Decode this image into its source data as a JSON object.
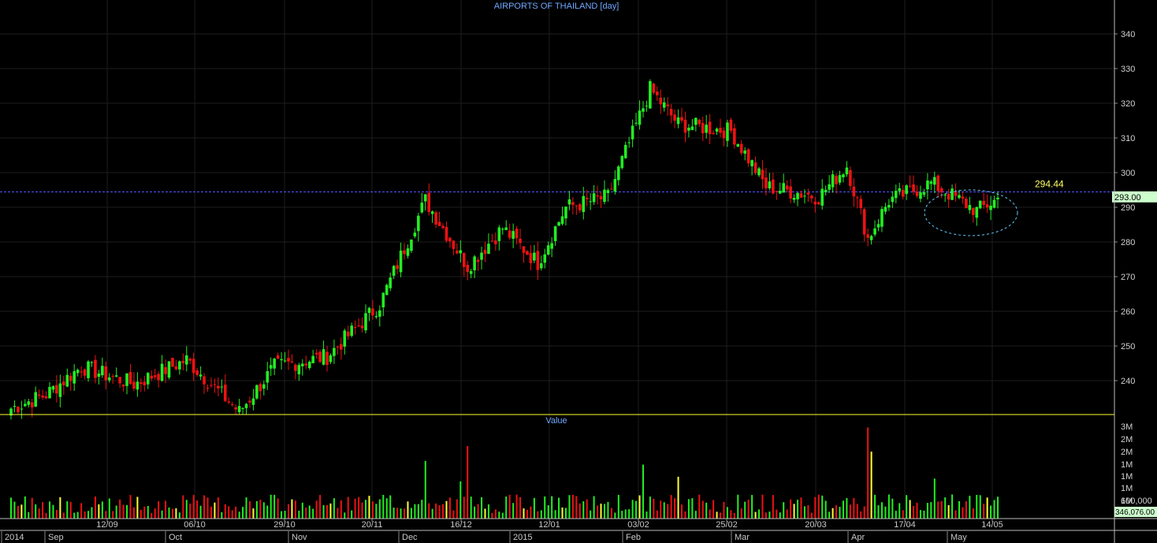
{
  "chart_data": [
    {
      "type": "candlestick",
      "title": "AIRPORTS OF THAILAND [day]",
      "ylim": [
        231,
        345
      ],
      "y_ticks": [
        240,
        250,
        260,
        270,
        280,
        290,
        300,
        310,
        320,
        330,
        340
      ],
      "y_tick_labels": [
        "240",
        "250",
        "260",
        "270",
        "280",
        "290",
        "300",
        "310",
        "320",
        "330",
        "340"
      ],
      "reference_line": {
        "value": 294.44,
        "label": "294.44",
        "color": "#5555ff"
      },
      "last_price": {
        "value": 293.0,
        "label": "293.00"
      },
      "annotation": "dashed ellipse around May consolidation",
      "grid": true,
      "x_labels_top": [
        "12/09",
        "06/10",
        "29/10",
        "20/11",
        "16/12",
        "12/01",
        "03/02",
        "25/02",
        "20/03",
        "17/04",
        "14/05"
      ],
      "x_labels_bottom": [
        "2014",
        "Sep",
        "Oct",
        "Nov",
        "Dec",
        "2015",
        "Feb",
        "Mar",
        "Apr",
        "May"
      ],
      "series_segments": [
        {
          "from": 0,
          "to": 10,
          "start": 232,
          "end": 236
        },
        {
          "from": 10,
          "to": 20,
          "start": 236,
          "end": 244
        },
        {
          "from": 20,
          "to": 35,
          "start": 244,
          "end": 239
        },
        {
          "from": 35,
          "to": 50,
          "start": 239,
          "end": 246
        },
        {
          "from": 50,
          "to": 65,
          "start": 246,
          "end": 231
        },
        {
          "from": 65,
          "to": 75,
          "start": 231,
          "end": 244
        },
        {
          "from": 75,
          "to": 90,
          "start": 244,
          "end": 247
        },
        {
          "from": 90,
          "to": 105,
          "start": 247,
          "end": 262
        },
        {
          "from": 105,
          "to": 118,
          "start": 262,
          "end": 292
        },
        {
          "from": 118,
          "to": 130,
          "start": 292,
          "end": 273
        },
        {
          "from": 130,
          "to": 140,
          "start": 273,
          "end": 284
        },
        {
          "from": 140,
          "to": 150,
          "start": 284,
          "end": 274
        },
        {
          "from": 150,
          "to": 158,
          "start": 274,
          "end": 290
        },
        {
          "from": 158,
          "to": 170,
          "start": 290,
          "end": 293
        },
        {
          "from": 170,
          "to": 182,
          "start": 293,
          "end": 324
        },
        {
          "from": 182,
          "to": 190,
          "start": 324,
          "end": 314
        },
        {
          "from": 190,
          "to": 205,
          "start": 314,
          "end": 312
        },
        {
          "from": 205,
          "to": 215,
          "start": 312,
          "end": 296
        },
        {
          "from": 215,
          "to": 230,
          "start": 296,
          "end": 293
        },
        {
          "from": 230,
          "to": 238,
          "start": 293,
          "end": 302
        },
        {
          "from": 238,
          "to": 244,
          "start": 302,
          "end": 281
        },
        {
          "from": 244,
          "to": 250,
          "start": 281,
          "end": 292
        },
        {
          "from": 250,
          "to": 262,
          "start": 292,
          "end": 297
        },
        {
          "from": 262,
          "to": 275,
          "start": 297,
          "end": 289
        },
        {
          "from": 275,
          "to": 282,
          "start": 289,
          "end": 293
        }
      ]
    },
    {
      "type": "bar",
      "title": "Value",
      "y_tick_labels": [
        "3M",
        "2M",
        "2M",
        "1M",
        "1M",
        "1M",
        "1M",
        "600,000"
      ],
      "last_value_label": "346,076.00"
    }
  ]
}
